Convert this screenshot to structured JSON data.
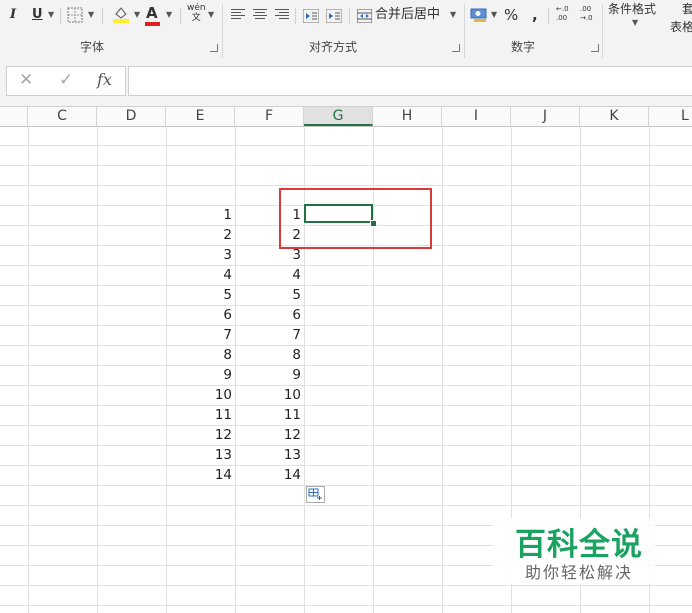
{
  "ribbon": {
    "italic": "I",
    "underline": "U",
    "font_color_letter": "A",
    "phonetic": "wén\n文",
    "merge_label": "合并后居中",
    "percent": "%",
    "comma": ",",
    "inc_decimal": "←.0\n.00",
    "dec_decimal": ".00\n→.0",
    "conditional_format": "条件格式",
    "table_format_partial": "套\n表格",
    "groups": {
      "font": "字体",
      "alignment": "对齐方式",
      "number": "数字"
    }
  },
  "formula_bar": {
    "cancel": "✕",
    "enter": "✓",
    "fx": "fx",
    "value": ""
  },
  "columns": [
    "C",
    "D",
    "E",
    "F",
    "G",
    "H",
    "I",
    "J",
    "K",
    "L"
  ],
  "selected_column": "G",
  "column_e": [
    "1",
    "2",
    "3",
    "4",
    "5",
    "6",
    "7",
    "8",
    "9",
    "10",
    "11",
    "12",
    "13",
    "14"
  ],
  "column_f": [
    "1",
    "2",
    "3",
    "4",
    "5",
    "6",
    "7",
    "8",
    "9",
    "10",
    "11",
    "12",
    "13",
    "14"
  ],
  "watermark": {
    "main": "百科全说",
    "sub": "助你轻松解决"
  },
  "colors": {
    "accent": "#217346",
    "highlight_box": "#d93b3b",
    "watermark": "#1aa260"
  }
}
